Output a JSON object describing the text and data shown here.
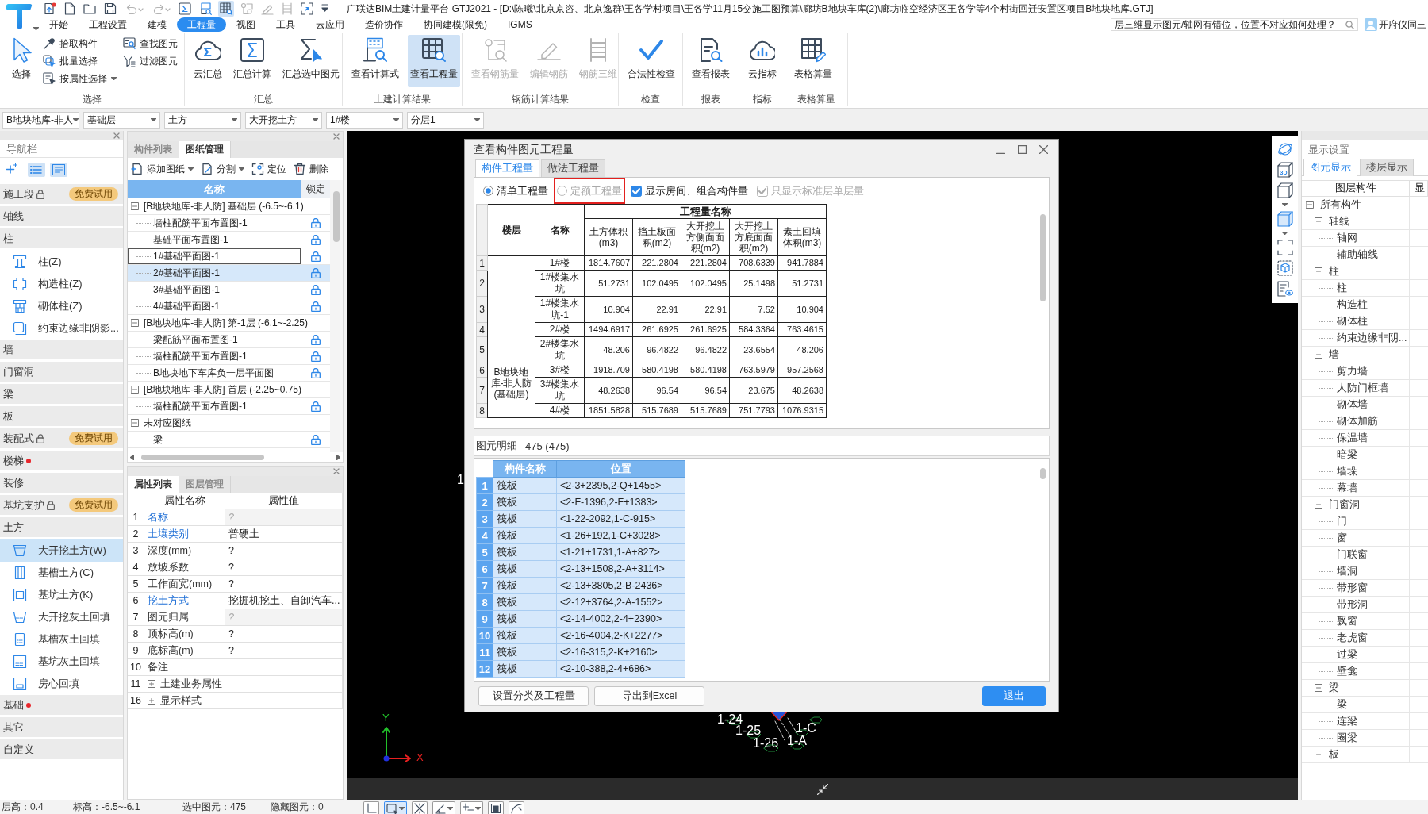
{
  "app": {
    "title": "广联达BIM土建计量平台 GTJ2021 - [D:\\陈曦\\北京京咨、北京逸群\\王各学村项目\\王各学11月15交施工图预算\\廊坊B地块车库(2)\\廊坊临空经济区王各学等4个村街回迁安置区项目B地块地库.GTJ]"
  },
  "quick_tools": [
    {
      "kind": "upload",
      "selected": false,
      "disabled": false
    },
    {
      "kind": "new",
      "selected": false,
      "disabled": false
    },
    {
      "kind": "open",
      "selected": false,
      "disabled": false
    },
    {
      "kind": "save",
      "selected": false,
      "disabled": false
    },
    {
      "kind": "undo",
      "selected": false,
      "disabled": true
    },
    {
      "kind": "redo",
      "selected": false,
      "disabled": true
    },
    {
      "kind": "sum",
      "selected": false,
      "disabled": false
    },
    {
      "kind": "formula",
      "selected": false,
      "disabled": false
    },
    {
      "kind": "quantity",
      "selected": true,
      "disabled": false
    },
    {
      "kind": "rebar",
      "selected": false,
      "disabled": true
    },
    {
      "kind": "pen",
      "selected": false,
      "disabled": true
    },
    {
      "kind": "ladder",
      "selected": false,
      "disabled": true
    },
    {
      "kind": "capture",
      "selected": false,
      "disabled": false
    },
    {
      "kind": "more",
      "selected": false,
      "disabled": false
    }
  ],
  "menu": {
    "tabs": [
      {
        "label": "开始",
        "selected": false
      },
      {
        "label": "工程设置",
        "selected": false
      },
      {
        "label": "建模",
        "selected": false
      },
      {
        "label": "工程量",
        "selected": true
      },
      {
        "label": "视图",
        "selected": false
      },
      {
        "label": "工具",
        "selected": false
      },
      {
        "label": "云应用",
        "selected": false
      },
      {
        "label": "造价协作",
        "selected": false
      },
      {
        "label": "协同建模(限免)",
        "selected": false
      },
      {
        "label": "IGMS",
        "selected": false
      }
    ],
    "help_search": {
      "value": "层三维显示图元/轴网有错位，位置不对应如何处理？"
    },
    "user": {
      "name": "开府仪同三"
    }
  },
  "ribbon": [
    {
      "label": "选择",
      "buttons": [
        {
          "kind": "large",
          "label": "选择",
          "active": false,
          "disabled": false,
          "menu": false
        },
        {
          "kind": "small",
          "label": "拾取构件",
          "active": false,
          "disabled": false,
          "menu": false
        },
        {
          "kind": "small",
          "label": "批量选择",
          "active": false,
          "disabled": false,
          "menu": false
        },
        {
          "kind": "small",
          "label": "按属性选择",
          "active": false,
          "disabled": false,
          "menu": true
        },
        {
          "kind": "small",
          "label": "查找图元",
          "active": false,
          "disabled": false,
          "menu": false
        },
        {
          "kind": "small",
          "label": "过滤图元",
          "active": false,
          "disabled": false,
          "menu": false
        }
      ]
    },
    {
      "label": "汇总",
      "buttons": [
        {
          "kind": "large",
          "label": "云汇总",
          "active": false,
          "disabled": false,
          "menu": false
        },
        {
          "kind": "large",
          "label": "汇总计算",
          "active": false,
          "disabled": false,
          "menu": false
        },
        {
          "kind": "large",
          "label": "汇总选中图元",
          "active": false,
          "disabled": false,
          "menu": false
        }
      ]
    },
    {
      "label": "土建计算结果",
      "buttons": [
        {
          "kind": "large",
          "label": "查看计算式",
          "active": false,
          "disabled": false,
          "menu": false
        },
        {
          "kind": "large",
          "label": "查看工程量",
          "active": true,
          "disabled": false,
          "menu": false
        }
      ]
    },
    {
      "label": "钢筋计算结果",
      "buttons": [
        {
          "kind": "large",
          "label": "查看钢筋量",
          "active": false,
          "disabled": true,
          "menu": false
        },
        {
          "kind": "large",
          "label": "编辑钢筋",
          "active": false,
          "disabled": true,
          "menu": false
        },
        {
          "kind": "large",
          "label": "钢筋三维",
          "active": false,
          "disabled": true,
          "menu": false
        }
      ]
    },
    {
      "label": "检查",
      "buttons": [
        {
          "kind": "large",
          "label": "合法性检查",
          "active": false,
          "disabled": false,
          "menu": false
        }
      ]
    },
    {
      "label": "报表",
      "buttons": [
        {
          "kind": "large",
          "label": "查看报表",
          "active": false,
          "disabled": false,
          "menu": false
        }
      ]
    },
    {
      "label": "指标",
      "buttons": [
        {
          "kind": "large",
          "label": "云指标",
          "active": false,
          "disabled": false,
          "menu": false
        }
      ]
    },
    {
      "label": "表格算量",
      "buttons": [
        {
          "kind": "large",
          "label": "表格算量",
          "active": false,
          "disabled": false,
          "menu": false
        }
      ]
    }
  ],
  "selectors": [
    "B地块地库-非人",
    "基础层",
    "土方",
    "大开挖土方",
    "1#楼",
    "分层1"
  ],
  "navigator": {
    "title": "导航栏",
    "tools": [
      {
        "kind": "add",
        "selected": false
      },
      {
        "kind": "list",
        "selected": true
      },
      {
        "kind": "detail",
        "selected": true
      }
    ],
    "categories": [
      {
        "label": "施工段",
        "locked": true,
        "badge": "免费试用",
        "alert": false
      },
      {
        "label": "轴线",
        "locked": false,
        "alert": false
      },
      {
        "label": "柱",
        "locked": false,
        "alert": false,
        "children": [
          {
            "label": "柱(Z)",
            "selected": false
          },
          {
            "label": "构造柱(Z)",
            "selected": false
          },
          {
            "label": "砌体柱(Z)",
            "selected": false
          },
          {
            "label": "约束边缘非阴影...",
            "selected": false
          }
        ]
      },
      {
        "label": "墙",
        "locked": false,
        "alert": false
      },
      {
        "label": "门窗洞",
        "locked": false,
        "alert": false
      },
      {
        "label": "梁",
        "locked": false,
        "alert": false
      },
      {
        "label": "板",
        "locked": false,
        "alert": false
      },
      {
        "label": "装配式",
        "locked": true,
        "badge": "免费试用",
        "alert": false
      },
      {
        "label": "楼梯",
        "locked": false,
        "alert": true
      },
      {
        "label": "装修",
        "locked": false,
        "alert": false
      },
      {
        "label": "基坑支护",
        "locked": true,
        "badge": "免费试用",
        "alert": false
      },
      {
        "label": "土方",
        "locked": false,
        "alert": false,
        "children": [
          {
            "label": "大开挖土方(W)",
            "selected": true
          },
          {
            "label": "基槽土方(C)",
            "selected": false
          },
          {
            "label": "基坑土方(K)",
            "selected": false
          },
          {
            "label": "大开挖灰土回填",
            "selected": false
          },
          {
            "label": "基槽灰土回填",
            "selected": false
          },
          {
            "label": "基坑灰土回填",
            "selected": false
          },
          {
            "label": "房心回填",
            "selected": false
          }
        ]
      },
      {
        "label": "基础",
        "locked": false,
        "alert": true
      },
      {
        "label": "其它",
        "locked": false,
        "alert": false
      },
      {
        "label": "自定义",
        "locked": false,
        "alert": false
      }
    ]
  },
  "drawings": {
    "tabs": [
      {
        "label": "构件列表",
        "selected": false
      },
      {
        "label": "图纸管理",
        "selected": true
      }
    ],
    "tools": [
      {
        "label": "添加图纸",
        "menu": true
      },
      {
        "label": "分割",
        "menu": true
      },
      {
        "label": "定位",
        "menu": false
      },
      {
        "label": "删除",
        "menu": false
      }
    ],
    "columns": [
      "名称",
      "锁定"
    ],
    "groups": [
      {
        "label": "[B地块地库-非人防] 基础层 (-6.5~-6.1)",
        "expanded": true,
        "children": [
          {
            "label": "墙柱配筋平面布置图-1",
            "selected": false,
            "focused": false
          },
          {
            "label": "基础平面布置图-1",
            "selected": false,
            "focused": false
          },
          {
            "label": "1#基础平面图-1",
            "selected": false,
            "focused": true
          },
          {
            "label": "2#基础平面图-1",
            "selected": true,
            "focused": false
          },
          {
            "label": "3#基础平面图-1",
            "selected": false,
            "focused": false
          },
          {
            "label": "4#基础平面图-1",
            "selected": false,
            "focused": false
          }
        ]
      },
      {
        "label": "[B地块地库-非人防] 第-1层 (-6.1~-2.25)",
        "expanded": true,
        "children": [
          {
            "label": "梁配筋平面布置图-1",
            "selected": false,
            "focused": false
          },
          {
            "label": "墙柱配筋平面布置图-1",
            "selected": false,
            "focused": false
          },
          {
            "label": "B地块地下车库负一层平面图",
            "selected": false,
            "focused": false
          }
        ]
      },
      {
        "label": "[B地块地库-非人防] 首层 (-2.25~0.75)",
        "expanded": true,
        "children": [
          {
            "label": "墙柱配筋平面布置图-1",
            "selected": false,
            "focused": false
          }
        ]
      },
      {
        "label": "未对应图纸",
        "expanded": true,
        "children": [
          {
            "label": "梁",
            "selected": false,
            "focused": false
          }
        ]
      }
    ]
  },
  "properties": {
    "tabs": [
      {
        "label": "属性列表",
        "selected": true
      },
      {
        "label": "图层管理",
        "selected": false
      }
    ],
    "columns": [
      "属性名称",
      "属性值"
    ],
    "rows": [
      {
        "index": "1",
        "kind": "field",
        "name": "名称",
        "value": "?",
        "public": true,
        "value_disabled": true
      },
      {
        "index": "2",
        "kind": "field",
        "name": "土壤类别",
        "value": "普硬土",
        "public": true,
        "value_disabled": false
      },
      {
        "index": "3",
        "kind": "field",
        "name": "深度(mm)",
        "value": "?",
        "public": false,
        "value_disabled": false
      },
      {
        "index": "4",
        "kind": "field",
        "name": "放坡系数",
        "value": "?",
        "public": false,
        "value_disabled": false
      },
      {
        "index": "5",
        "kind": "field",
        "name": "工作面宽(mm)",
        "value": "?",
        "public": false,
        "value_disabled": false
      },
      {
        "index": "6",
        "kind": "field",
        "name": "挖土方式",
        "value": "挖掘机挖土、自卸汽车...",
        "public": true,
        "value_disabled": false
      },
      {
        "index": "7",
        "kind": "field",
        "name": "图元归属",
        "value": "?",
        "public": false,
        "value_disabled": true
      },
      {
        "index": "8",
        "kind": "field",
        "name": "顶标高(m)",
        "value": "?",
        "public": false,
        "value_disabled": false
      },
      {
        "index": "9",
        "kind": "field",
        "name": "底标高(m)",
        "value": "?",
        "public": false,
        "value_disabled": false
      },
      {
        "index": "10",
        "kind": "field",
        "name": "备注",
        "public": false
      },
      {
        "index": "11",
        "kind": "group",
        "name": "土建业务属性",
        "public": false,
        "expanded": false
      },
      {
        "index": "16",
        "kind": "group",
        "name": "显示样式",
        "public": false,
        "expanded": false
      }
    ]
  },
  "canvas": {
    "labels": [
      "1",
      "1-24",
      "1-25",
      "1-26",
      "1-A",
      "1-C"
    ],
    "axis": {
      "x": "X",
      "y": "Y"
    }
  },
  "dialog": {
    "title": "查看构件图元工程量",
    "tabs": [
      {
        "label": "构件工程量",
        "selected": true
      },
      {
        "label": "做法工程量",
        "selected": false
      }
    ],
    "options": [
      {
        "kind": "radio",
        "label": "清单工程量",
        "checked": true,
        "disabled": false,
        "highlighted": false
      },
      {
        "kind": "radio",
        "label": "定额工程量",
        "checked": false,
        "disabled": true,
        "highlighted": true
      },
      {
        "kind": "checkbox",
        "label": "显示房间、组合构件量",
        "checked": true,
        "disabled": false,
        "highlighted": false
      },
      {
        "kind": "checkbox",
        "label": "只显示标准层单层量",
        "checked": true,
        "disabled": true,
        "highlighted": false
      }
    ],
    "quantity_table": {
      "columns": [
        "楼层",
        "名称"
      ],
      "group_header": "工程量名称",
      "quantity_columns": [
        "土方体积(m3)",
        "挡土板面积(m2)",
        "大开挖土方侧面面积(m2)",
        "大开挖土方底面面积(m2)",
        "素土回填体积(m3)"
      ],
      "floor": "B地块地库-非人防(基础层)",
      "rows": [
        {
          "index": "1",
          "name": "1#楼",
          "values": [
            "1814.7607",
            "221.2804",
            "221.2804",
            "708.6339",
            "941.7884"
          ]
        },
        {
          "index": "2",
          "name": "1#楼集水坑",
          "values": [
            "51.2731",
            "102.0495",
            "102.0495",
            "25.1498",
            "51.2731"
          ]
        },
        {
          "index": "3",
          "name": "1#楼集水坑-1",
          "values": [
            "10.904",
            "22.91",
            "22.91",
            "7.52",
            "10.904"
          ]
        },
        {
          "index": "4",
          "name": "2#楼",
          "values": [
            "1494.6917",
            "261.6925",
            "261.6925",
            "584.3364",
            "763.4615"
          ]
        },
        {
          "index": "5",
          "name": "2#楼集水坑",
          "values": [
            "48.206",
            "96.4822",
            "96.4822",
            "23.6554",
            "48.206"
          ]
        },
        {
          "index": "6",
          "name": "3#楼",
          "values": [
            "1918.709",
            "580.4198",
            "580.4198",
            "763.5979",
            "957.2568"
          ]
        },
        {
          "index": "7",
          "name": "3#楼集水坑",
          "values": [
            "48.2638",
            "96.54",
            "96.54",
            "23.675",
            "48.2638"
          ]
        },
        {
          "index": "8",
          "name": "4#楼",
          "values": [
            "1851.5828",
            "515.7689",
            "515.7689",
            "751.7793",
            "1076.9315"
          ]
        }
      ]
    },
    "detail": {
      "label": "图元明细",
      "count": "475 (475)",
      "columns": [
        "构件名称",
        "位置"
      ],
      "rows": [
        {
          "index": "1",
          "name": "筏板",
          "position": "<2-3+2395,2-Q+1455>",
          "selected": true
        },
        {
          "index": "2",
          "name": "筏板",
          "position": "<2-F-1396,2-F+1383>",
          "selected": true
        },
        {
          "index": "3",
          "name": "筏板",
          "position": "<1-22-2092,1-C-915>",
          "selected": true
        },
        {
          "index": "4",
          "name": "筏板",
          "position": "<1-26+192,1-C+3028>",
          "selected": true
        },
        {
          "index": "5",
          "name": "筏板",
          "position": "<1-21+1731,1-A+827>",
          "selected": true
        },
        {
          "index": "6",
          "name": "筏板",
          "position": "<2-13+1508,2-A+3114>",
          "selected": true
        },
        {
          "index": "7",
          "name": "筏板",
          "position": "<2-13+3805,2-B-2436>",
          "selected": true
        },
        {
          "index": "8",
          "name": "筏板",
          "position": "<2-12+3764,2-A-1552>",
          "selected": true
        },
        {
          "index": "9",
          "name": "筏板",
          "position": "<2-14-4002,2-4+2390>",
          "selected": true
        },
        {
          "index": "10",
          "name": "筏板",
          "position": "<2-16-4004,2-K+2277>",
          "selected": true
        },
        {
          "index": "11",
          "name": "筏板",
          "position": "<2-16-315,2-K+2160>",
          "selected": true
        },
        {
          "index": "12",
          "name": "筏板",
          "position": "<2-10-388,2-4+686>",
          "selected": true
        }
      ]
    },
    "buttons": [
      {
        "label": "设置分类及工程量",
        "primary": false
      },
      {
        "label": "导出到Excel",
        "primary": false
      },
      {
        "label": "退出",
        "primary": true
      }
    ]
  },
  "view_tools": [
    {
      "kind": "orbit",
      "menu": false
    },
    {
      "kind": "cube-3d",
      "label": "3D",
      "menu": false
    },
    {
      "kind": "cube",
      "menu": true
    },
    {
      "kind": "cube-filled",
      "menu": true
    },
    {
      "kind": "frame",
      "menu": false
    },
    {
      "kind": "dashed-cube",
      "menu": false
    },
    {
      "kind": "layer-list",
      "menu": false
    }
  ],
  "display_settings": {
    "title": "显示设置",
    "tabs": [
      {
        "label": "图元显示",
        "selected": true
      },
      {
        "label": "楼层显示",
        "selected": false
      }
    ],
    "columns": [
      "图层构件",
      "显"
    ],
    "tree": [
      {
        "label": "所有构件",
        "expanded": true,
        "children": [
          {
            "label": "轴线",
            "expanded": true,
            "children": [
              {
                "label": "轴网"
              },
              {
                "label": "辅助轴线"
              }
            ]
          },
          {
            "label": "柱",
            "expanded": true,
            "children": [
              {
                "label": "柱"
              },
              {
                "label": "构造柱"
              },
              {
                "label": "砌体柱"
              },
              {
                "label": "约束边缘非阴..."
              }
            ]
          },
          {
            "label": "墙",
            "expanded": true,
            "children": [
              {
                "label": "剪力墙"
              },
              {
                "label": "人防门框墙"
              },
              {
                "label": "砌体墙"
              },
              {
                "label": "砌体加筋"
              },
              {
                "label": "保温墙"
              },
              {
                "label": "暗梁"
              },
              {
                "label": "墙垛"
              },
              {
                "label": "幕墙"
              }
            ]
          },
          {
            "label": "门窗洞",
            "expanded": true,
            "children": [
              {
                "label": "门"
              },
              {
                "label": "窗"
              },
              {
                "label": "门联窗"
              },
              {
                "label": "墙洞"
              },
              {
                "label": "带形窗"
              },
              {
                "label": "带形洞"
              },
              {
                "label": "飘窗"
              },
              {
                "label": "老虎窗"
              },
              {
                "label": "过梁"
              },
              {
                "label": "壁龛"
              }
            ]
          },
          {
            "label": "梁",
            "expanded": true,
            "children": [
              {
                "label": "梁"
              },
              {
                "label": "连梁"
              },
              {
                "label": "圈梁"
              }
            ]
          },
          {
            "label": "板",
            "expanded": true
          }
        ]
      }
    ]
  },
  "status_bar": {
    "items": [
      "层高：0.4",
      "标高：-6.5~-6.1",
      "选中图元：475",
      "隐藏图元：0"
    ]
  },
  "bottom_tools": [
    {
      "kind": "ortho",
      "selected": false,
      "menu": false
    },
    {
      "kind": "rect-select",
      "selected": true,
      "menu": true
    },
    {
      "kind": "cross",
      "selected": false,
      "menu": false
    },
    {
      "kind": "angle",
      "selected": false,
      "menu": true
    },
    {
      "kind": "offset",
      "selected": false,
      "menu": true
    },
    {
      "kind": "layer",
      "selected": false,
      "menu": false
    },
    {
      "kind": "arc",
      "selected": false,
      "menu": false
    }
  ]
}
